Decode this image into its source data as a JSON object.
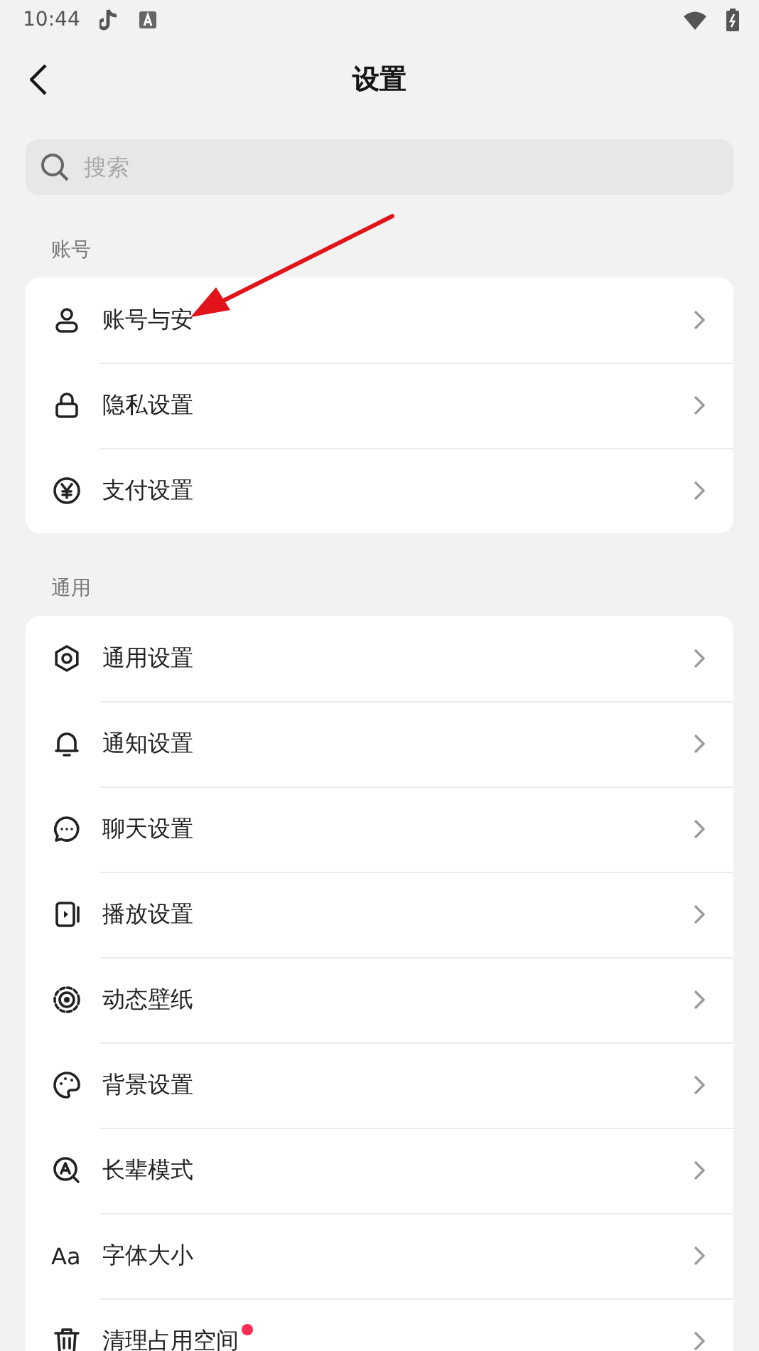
{
  "status_bar": {
    "time": "10:44"
  },
  "header": {
    "title": "设置"
  },
  "search": {
    "placeholder": "搜索"
  },
  "sections": [
    {
      "title": "账号",
      "items": [
        {
          "label": "账号与安",
          "new_dot": false
        },
        {
          "label": "隐私设置",
          "new_dot": false
        },
        {
          "label": "支付设置",
          "new_dot": false
        }
      ]
    },
    {
      "title": "通用",
      "items": [
        {
          "label": "通用设置",
          "new_dot": false
        },
        {
          "label": "通知设置",
          "new_dot": false
        },
        {
          "label": "聊天设置",
          "new_dot": false
        },
        {
          "label": "播放设置",
          "new_dot": false
        },
        {
          "label": "动态壁纸",
          "new_dot": false
        },
        {
          "label": "背景设置",
          "new_dot": false
        },
        {
          "label": "长辈模式",
          "new_dot": false
        },
        {
          "label": "字体大小",
          "new_dot": false,
          "icon_text": "Aa"
        },
        {
          "label": "清理占用空间",
          "new_dot": true
        }
      ]
    }
  ]
}
